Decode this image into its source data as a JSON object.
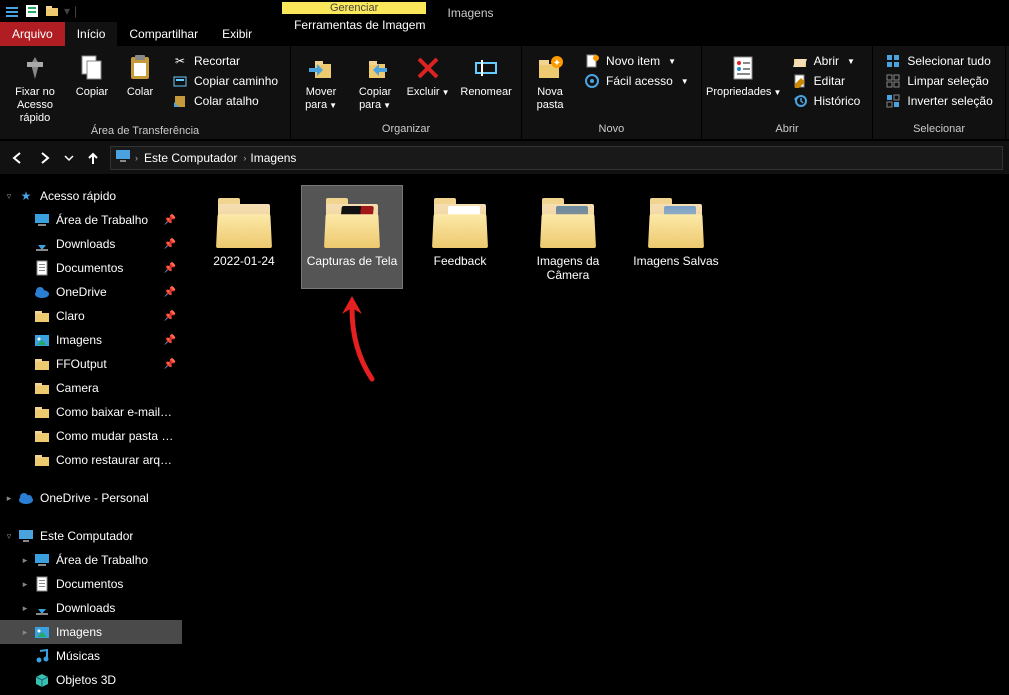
{
  "titlebar": {
    "title": "Imagens"
  },
  "tabs": {
    "file": "Arquivo",
    "home": "Início",
    "share": "Compartilhar",
    "view": "Exibir",
    "manage": "Gerenciar",
    "context_title": "Imagens",
    "context_sub": "Ferramentas de Imagem"
  },
  "ribbon": {
    "clipboard": {
      "pin": "Fixar no Acesso rápido",
      "copy": "Copiar",
      "paste": "Colar",
      "cut": "Recortar",
      "copy_path": "Copiar caminho",
      "paste_shortcut": "Colar atalho",
      "group": "Área de Transferência"
    },
    "organize": {
      "move_to": "Mover para",
      "copy_to": "Copiar para",
      "delete": "Excluir",
      "rename": "Renomear",
      "group": "Organizar"
    },
    "new": {
      "new_folder": "Nova pasta",
      "new_item": "Novo item",
      "easy_access": "Fácil acesso",
      "group": "Novo"
    },
    "open": {
      "properties": "Propriedades",
      "open": "Abrir",
      "edit": "Editar",
      "history": "Histórico",
      "group": "Abrir"
    },
    "select": {
      "select_all": "Selecionar tudo",
      "select_none": "Limpar seleção",
      "invert": "Inverter seleção",
      "group": "Selecionar"
    }
  },
  "breadcrumb": {
    "root": "Este Computador",
    "current": "Imagens"
  },
  "sidebar": {
    "quick_access": "Acesso rápido",
    "qa_items": [
      {
        "label": "Área de Trabalho",
        "icon": "desktop",
        "pinned": true
      },
      {
        "label": "Downloads",
        "icon": "downloads",
        "pinned": true
      },
      {
        "label": "Documentos",
        "icon": "documents",
        "pinned": true
      },
      {
        "label": "OneDrive",
        "icon": "onedrive",
        "pinned": true
      },
      {
        "label": "Claro",
        "icon": "folder",
        "pinned": true
      },
      {
        "label": "Imagens",
        "icon": "pictures",
        "pinned": true
      },
      {
        "label": "FFOutput",
        "icon": "folder",
        "pinned": true
      },
      {
        "label": "Camera",
        "icon": "folder",
        "pinned": false
      },
      {
        "label": "Como baixar e-mails do",
        "icon": "folder",
        "pinned": false
      },
      {
        "label": "Como mudar pasta de p",
        "icon": "folder",
        "pinned": false
      },
      {
        "label": "Como restaurar arquivos",
        "icon": "folder",
        "pinned": false
      }
    ],
    "onedrive_personal": "OneDrive - Personal",
    "this_pc": "Este Computador",
    "pc_items": [
      {
        "label": "Área de Trabalho",
        "icon": "desktop"
      },
      {
        "label": "Documentos",
        "icon": "documents"
      },
      {
        "label": "Downloads",
        "icon": "downloads"
      },
      {
        "label": "Imagens",
        "icon": "pictures",
        "selected": true
      },
      {
        "label": "Músicas",
        "icon": "music"
      },
      {
        "label": "Objetos 3D",
        "icon": "objects3d"
      }
    ]
  },
  "folders": [
    {
      "label": "2022-01-24",
      "hint": "empty"
    },
    {
      "label": "Capturas de Tela",
      "hint": "dark",
      "selected": true
    },
    {
      "label": "Feedback",
      "hint": "paper"
    },
    {
      "label": "Imagens da Câmera",
      "hint": "photo1"
    },
    {
      "label": "Imagens Salvas",
      "hint": "photo2"
    }
  ],
  "colors": {
    "accent_red": "#b01d23",
    "manage_yellow": "#fbe85a"
  }
}
